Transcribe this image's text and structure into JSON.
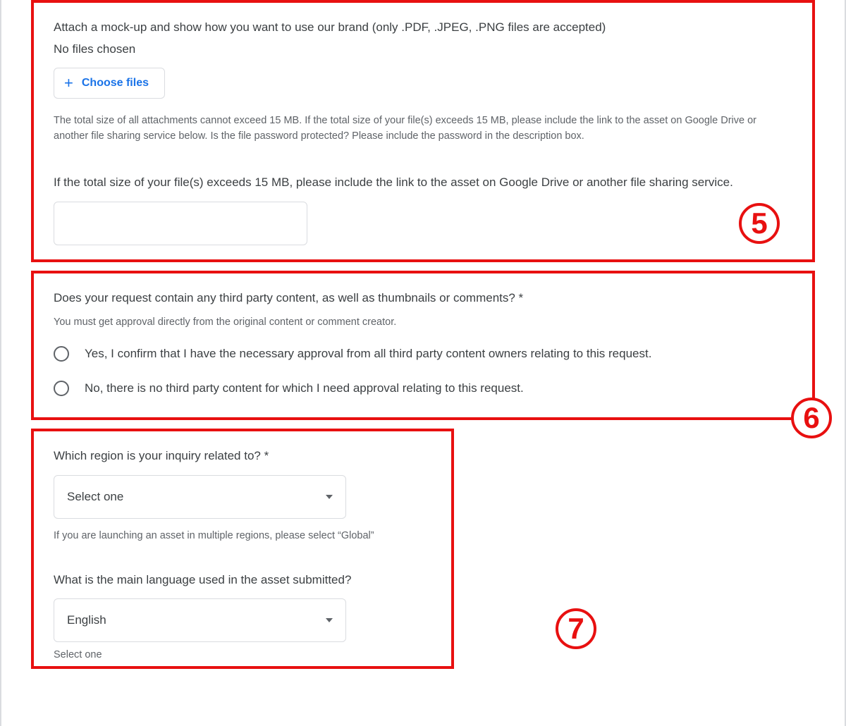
{
  "section5": {
    "label": "Attach a mock-up and show how you want to use our brand (only .PDF, .JPEG, .PNG files are accepted)",
    "no_files": "No files chosen",
    "choose_files": "Choose files",
    "helper": "The total size of all attachments cannot exceed 15 MB. If the total size of your file(s) exceeds 15 MB, please include the link to the asset on Google Drive or another file sharing service below. Is the file password protected? Please include the password in the description box.",
    "link_label": "If the total size of your file(s) exceeds 15 MB, please include the link to the asset on Google Drive or another file sharing service.",
    "badge": "5"
  },
  "section6": {
    "question": "Does your request contain any third party content, as well as thumbnails or comments? *",
    "sub_helper": "You must get approval directly from the original content or comment creator.",
    "option_yes": "Yes, I confirm that I have the necessary approval from all third party content owners relating to this request.",
    "option_no": "No, there is no third party content for which I need approval relating to this request.",
    "badge": "6"
  },
  "section7": {
    "region_question": "Which region is your inquiry related to? *",
    "region_value": "Select one",
    "region_helper": "If you are launching an asset in multiple regions, please select “Global”",
    "language_question": "What is the main language used in the asset submitted?",
    "language_value": "English",
    "bottom_helper": "Select one",
    "badge": "7"
  }
}
